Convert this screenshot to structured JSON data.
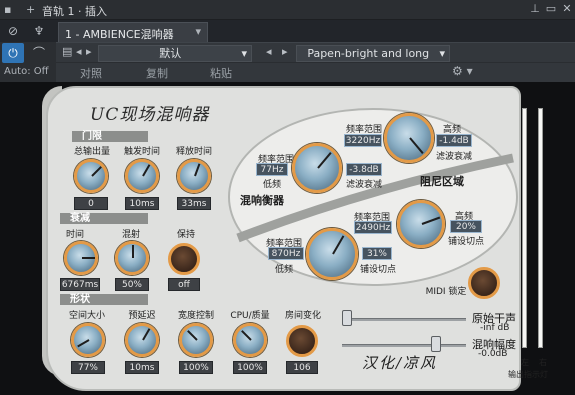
{
  "titlebar": {
    "title": "音轨 1 · 插入"
  },
  "tab": {
    "label": "1 - AMBIENCE混响器"
  },
  "host": {
    "auto": "Auto: Off",
    "compare": "对照",
    "copy": "复制",
    "paste": "粘贴",
    "preset_left": "默认",
    "preset_right": "Papen-bright and long"
  },
  "plugin": {
    "logo": "UC现场混响器",
    "credit": "汉化/凉风",
    "gate": {
      "header": "门限",
      "labels": [
        "总输出量",
        "触发时间",
        "释放时间"
      ],
      "values": [
        "0",
        "10ms",
        "33ms"
      ]
    },
    "decay": {
      "header": "衰减",
      "labels": [
        "时间",
        "混射",
        "保持"
      ],
      "values": [
        "6767ms",
        "50%",
        "off"
      ]
    },
    "shape": {
      "header": "形状",
      "labels": [
        "空间大小",
        "预延迟",
        "宽度控制",
        "CPU/质量",
        "房间变化"
      ],
      "values": [
        "77%",
        "10ms",
        "100%",
        "100%",
        "106"
      ]
    },
    "eq": {
      "title": "混响衡器",
      "low": {
        "range_label": "频率范围",
        "freq": "77Hz",
        "type": "低频",
        "cut": "-3.8dB",
        "cut_label": "滤波衰减"
      },
      "high": {
        "range_label": "频率范围",
        "freq": "3220Hz",
        "high_label": "高频",
        "cut": "-1.4dB",
        "cut_label": "滤波衰减"
      }
    },
    "damping": {
      "title": "阻尼区域",
      "high": {
        "range_label": "频率范围",
        "freq": "2490Hz",
        "high_label": "高频",
        "amount": "20%",
        "amount_label": "铺设切点"
      },
      "low": {
        "range_label": "频率范围",
        "freq": "870Hz",
        "type": "低频",
        "amount": "31%",
        "amount_label": "铺设切点"
      }
    },
    "midi_lock": "MIDI 锁定",
    "dry": {
      "label": "原始干声",
      "value": "-inf dB",
      "level": 0.0
    },
    "wet": {
      "label": "混响幅度",
      "value": "-0.0dB",
      "level": 0.78
    },
    "meter": {
      "left": "左",
      "right": "右",
      "caption": "输出指示灯"
    }
  },
  "colors": {
    "accent": "#e39a47",
    "knob": "#8aaec4",
    "host_blue": "#2f74b5"
  }
}
